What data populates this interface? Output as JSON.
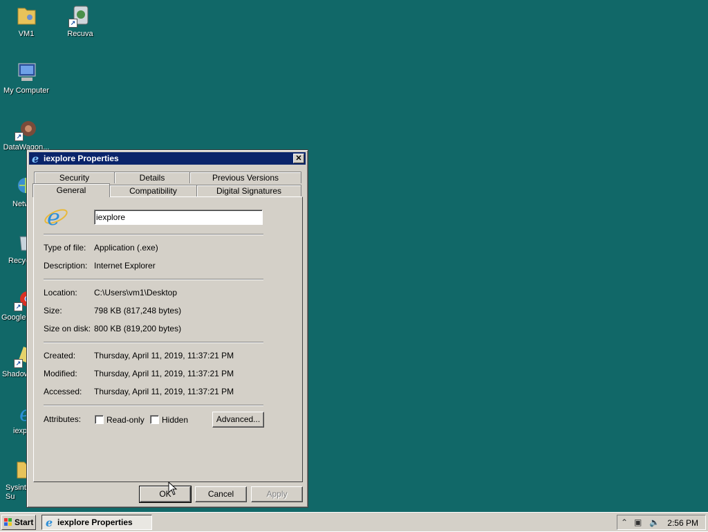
{
  "desktop": {
    "background": "#116868",
    "icons": [
      {
        "label": "VM1",
        "icon": "folder-user-icon"
      },
      {
        "label": "Recuva",
        "icon": "recuva-icon"
      },
      {
        "label": "My Computer",
        "icon": "computer-icon"
      },
      {
        "label": "DataWagon...",
        "icon": "datawagon-icon"
      },
      {
        "label": "Netw",
        "icon": "network-icon"
      },
      {
        "label": "Recyc",
        "icon": "recycle-bin-icon"
      },
      {
        "label": "Google",
        "icon": "chrome-icon"
      },
      {
        "label": "Shadow",
        "icon": "shadow-icon"
      },
      {
        "label": "iexp",
        "icon": "ie-icon"
      },
      {
        "label": "Sysint\nSu",
        "icon": "folder-icon"
      }
    ]
  },
  "dialog": {
    "title": "iexplore Properties",
    "close_label": "✕",
    "tabs_back": [
      "Security",
      "Details",
      "Previous Versions"
    ],
    "tabs_front": [
      "General",
      "Compatibility",
      "Digital Signatures"
    ],
    "active_tab": "General",
    "general": {
      "file_name": "iexplore",
      "type_label": "Type of file:",
      "type_value": "Application (.exe)",
      "desc_label": "Description:",
      "desc_value": "Internet Explorer",
      "location_label": "Location:",
      "location_value": "C:\\Users\\vm1\\Desktop",
      "size_label": "Size:",
      "size_value": "798 KB (817,248 bytes)",
      "sizedisk_label": "Size on disk:",
      "sizedisk_value": "800 KB (819,200 bytes)",
      "created_label": "Created:",
      "created_value": "Thursday, April 11, 2019, 11:37:21 PM",
      "modified_label": "Modified:",
      "modified_value": "Thursday, April 11, 2019, 11:37:21 PM",
      "accessed_label": "Accessed:",
      "accessed_value": "Thursday, April 11, 2019, 11:37:21 PM",
      "attributes_label": "Attributes:",
      "readonly_label": "Read-only",
      "hidden_label": "Hidden",
      "advanced_label": "Advanced..."
    },
    "buttons": {
      "ok": "OK",
      "cancel": "Cancel",
      "apply": "Apply"
    }
  },
  "taskbar": {
    "start_label": "Start",
    "task_label": "iexplore Properties",
    "clock": "2:56 PM"
  }
}
